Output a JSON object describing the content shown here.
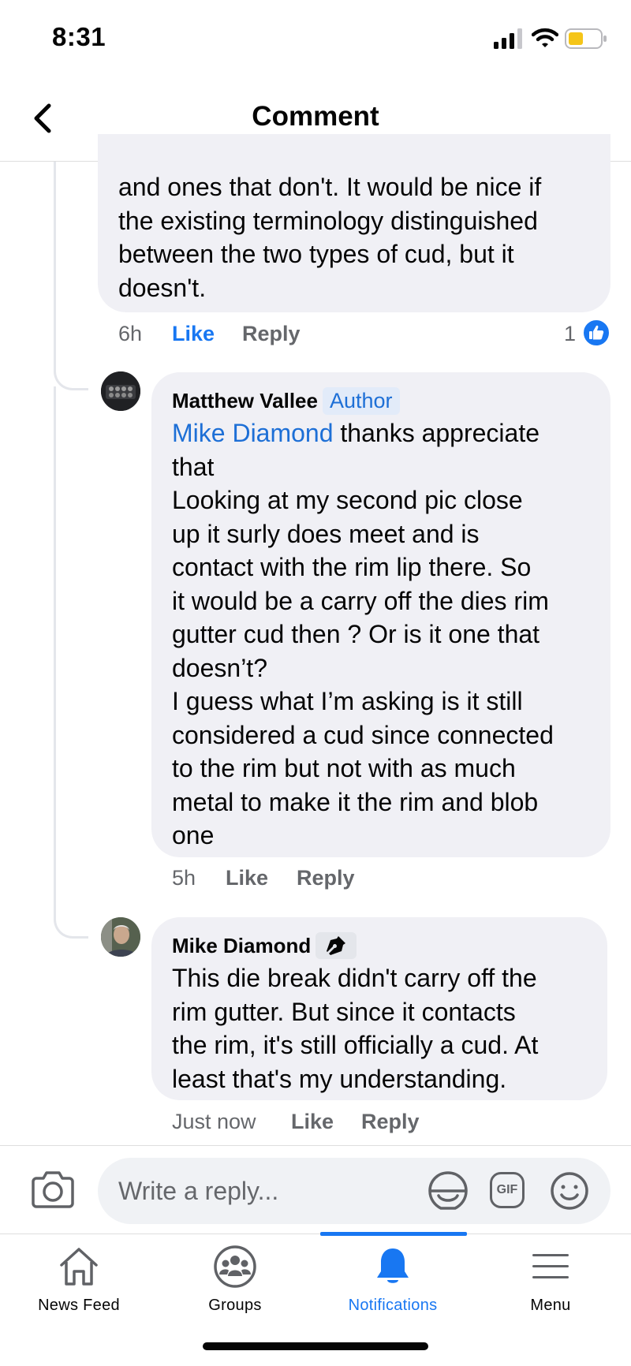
{
  "status_bar": {
    "time": "8:31"
  },
  "header": {
    "title": "Comment"
  },
  "comments": [
    {
      "text": "and ones that don't.  It would be nice if\nthe existing terminology distinguished\nbetween the two types of cud, but it\ndoesn't.",
      "time": "6h",
      "like_label": "Like",
      "reply_label": "Reply",
      "reaction_count": "1"
    },
    {
      "author": "Matthew Vallee",
      "badge": "Author",
      "mention": "Mike Diamond",
      "text_first": " thanks appreciate\nthat\nLooking at my second pic close\nup it surly does meet and is\ncontact with the rim lip there.  So\nit would be a carry off the dies rim\ngutter cud then ? Or is it one that\ndoesn’t?\nI guess what I’m asking is it still\nconsidered a cud since connected\nto the rim but not with as much\nmetal to make it the rim and blob\none",
      "time": "5h",
      "like_label": "Like",
      "reply_label": "Reply"
    },
    {
      "author": "Mike Diamond",
      "badge_icon": "pen-nib-icon",
      "text": "This die break didn't carry off the\nrim gutter.  But since it contacts\nthe rim, it's still officially a cud.  At\nleast that's my understanding.",
      "time": "Just now",
      "like_label": "Like",
      "reply_label": "Reply"
    }
  ],
  "composer": {
    "placeholder": "Write a reply...",
    "gif_label": "GIF"
  },
  "tabs": [
    {
      "label": "News Feed",
      "icon": "home-icon",
      "active": false
    },
    {
      "label": "Groups",
      "icon": "groups-icon",
      "active": false
    },
    {
      "label": "Notifications",
      "icon": "bell-icon",
      "active": true
    },
    {
      "label": "Menu",
      "icon": "menu-icon",
      "active": false
    }
  ],
  "colors": {
    "accent": "#1877f2",
    "bubble": "#f0f0f5",
    "secondary_text": "#65676b",
    "mention": "#1d6fd6"
  }
}
